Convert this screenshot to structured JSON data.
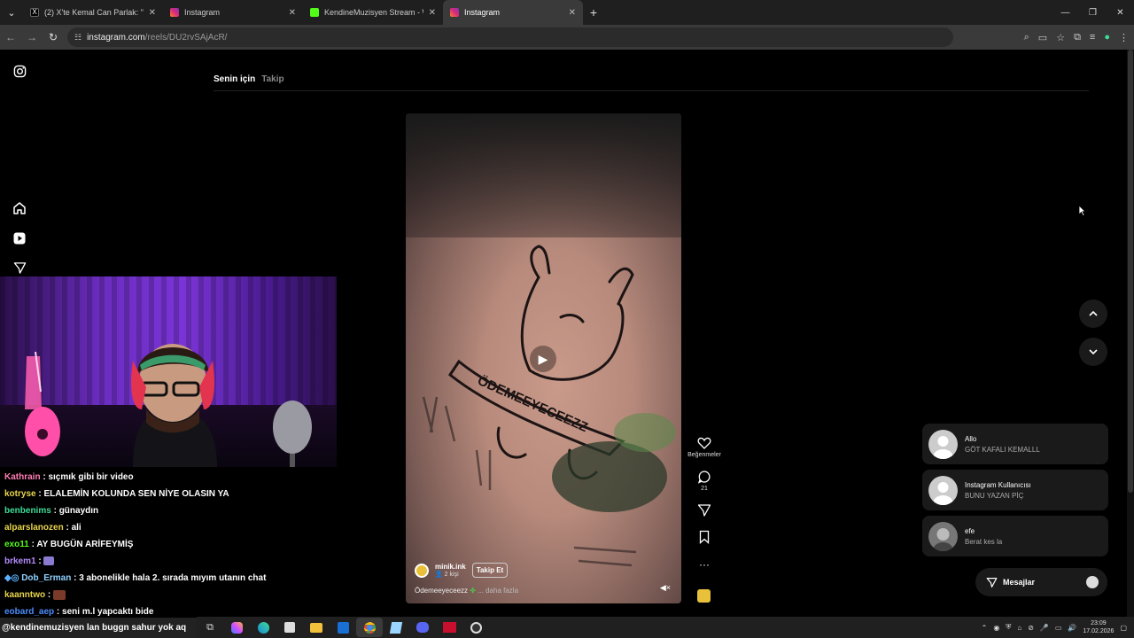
{
  "browser": {
    "tabs": [
      {
        "title": "(2) X'te Kemal Can Parlak: \"ya k",
        "favicon_color": "#000000",
        "active": false
      },
      {
        "title": "Instagram",
        "favicon_color": "#d6249f",
        "active": false
      },
      {
        "title": "KendineMuzisyen Stream - Wat",
        "favicon_color": "#53fc18",
        "active": false
      },
      {
        "title": "Instagram",
        "favicon_color": "#d6249f",
        "active": true
      }
    ],
    "url_host": "instagram.com",
    "url_path": "/reels/DU2rvSAjAcR/"
  },
  "instagram": {
    "feed_tabs": {
      "for_you": "Senin için",
      "following": "Takip"
    },
    "reel": {
      "username": "minik.ink",
      "viewers": "2 kişi",
      "follow_label": "Takip Et",
      "caption": "Ödemeeyeceezz",
      "caption_more": "... daha fazla"
    },
    "actions": {
      "likes_label": "Beğenmeler",
      "comment_count": "21"
    },
    "messages": [
      {
        "name": "Allo",
        "text": "GÖT KAFALI KEMALLL"
      },
      {
        "name": "Instagram Kullanıcısı",
        "text": "BUNU YAZAN PİÇ"
      },
      {
        "name": "efe",
        "text": "Berat kes la"
      }
    ],
    "messages_button": "Mesajlar"
  },
  "stream_chat": [
    {
      "user": "Kathrain",
      "color": "#ff7eb6",
      "text": "sıçmık gibi bir video"
    },
    {
      "user": "kotryse",
      "color": "#e8d44d",
      "text": "ELALEMİN KOLUNDA SEN NİYE OLASIN YA"
    },
    {
      "user": "benbenims",
      "color": "#3ddc97",
      "text": "günaydın"
    },
    {
      "user": "alparslanozen",
      "color": "#e8d44d",
      "text": "ali"
    },
    {
      "user": "exo11",
      "color": "#53fc18",
      "text": "AY BUGÜN ARİFEYMİŞ"
    },
    {
      "user": "brkem1",
      "color": "#b58cff",
      "text": ""
    },
    {
      "user": "Dob_Erman",
      "color": "#8fd0ff",
      "text": "3 abonelikle hala 2. sırada mıyım utanın chat"
    },
    {
      "user": "kaanntwo",
      "color": "#e8d44d",
      "text": ""
    },
    {
      "user": "eobard_aep",
      "color": "#4d8cff",
      "text": "seni m.l yapcaktı bide"
    }
  ],
  "ticker_text": "@kendinemuzisyen lan buggn sahur yok aq",
  "taskbar": {
    "time": "23:09",
    "date": "17.02.2026"
  }
}
